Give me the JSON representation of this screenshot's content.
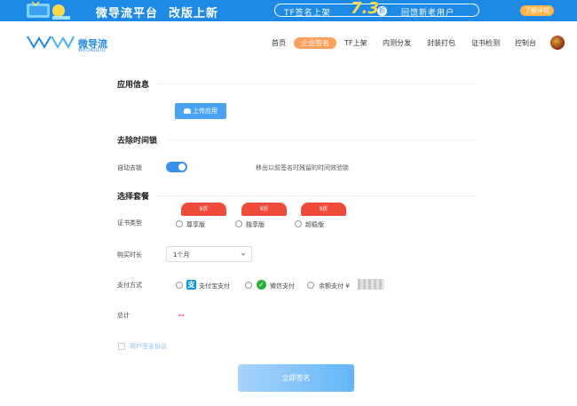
{
  "banner": {
    "title": "微导流平台",
    "subtitle": "改版上新",
    "promo_left": "TF签名上架",
    "promo_number": "7.3",
    "promo_zhe": "折",
    "promo_right": "回馈新老用户",
    "detail_button": "了解详情"
  },
  "nav": {
    "logo_name": "微导流",
    "logo_sub": "WEDAOLIU",
    "items": [
      "首页",
      "企业签名",
      "TF上架",
      "内测分发",
      "封装打包",
      "证书检测",
      "控制台"
    ],
    "active_index": 1
  },
  "app_info": {
    "title": "应用信息",
    "upload_button": "上传应用"
  },
  "time_lock": {
    "title": "去除时间锁",
    "label": "自动去锁",
    "enabled": true,
    "description": "移出以前签名时残留的时间效验锁"
  },
  "package": {
    "title": "选择套餐",
    "cert_type_label": "证书类型",
    "options": [
      {
        "tag": "9折",
        "name": "尊享版"
      },
      {
        "tag": "9折",
        "name": "独享版"
      },
      {
        "tag": "9折",
        "name": "超稳版"
      }
    ],
    "duration_label": "购买时长",
    "duration_value": "1个月",
    "payment_label": "支付方式",
    "payments": [
      {
        "icon": "支",
        "name": "支付宝支付",
        "color": "#1296db"
      },
      {
        "icon": "✓",
        "name": "微信支付",
        "color": "#2aae3a"
      },
      {
        "icon": "",
        "name": "余额支付 ¥",
        "color": ""
      }
    ],
    "total_label": "总计",
    "total_value": "--",
    "agreement": "用户签名协议",
    "submit": "立即签名"
  },
  "colors": {
    "accent": "#1e88e5",
    "nav_active": "#ffa15a",
    "tag": "#f04a3a"
  }
}
